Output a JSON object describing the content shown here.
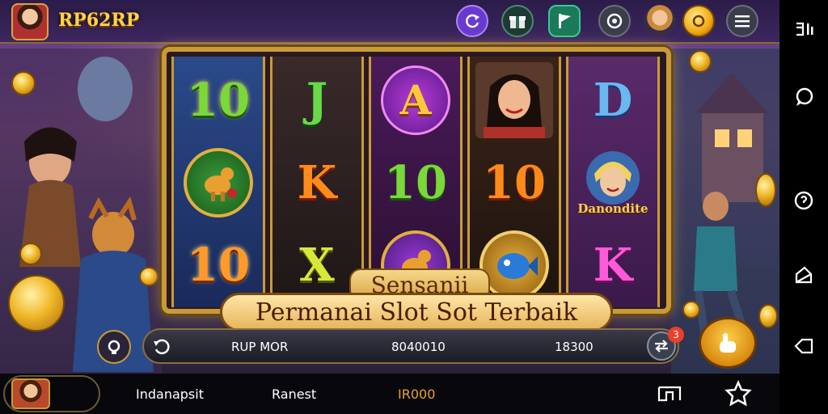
{
  "header": {
    "brand": "RP62RP",
    "icons": [
      "refresh-icon",
      "gift-icon",
      "flag-icon",
      "record-icon",
      "avatar-icon",
      "coin-icon",
      "menu-icon"
    ]
  },
  "reels": [
    [
      "10",
      "camel-symbol",
      "10"
    ],
    [
      "J",
      "K",
      "X"
    ],
    [
      "A",
      "10",
      "camel-symbol"
    ],
    [
      "woman-portrait",
      "10",
      "fish-symbol"
    ],
    [
      "D",
      "Danondite",
      "K"
    ]
  ],
  "banner": {
    "line1": "Sensanii",
    "line2": "Permanai Slot Sot Terbaik"
  },
  "controls": {
    "label1": "RUP MOR",
    "value1": "8040010",
    "value2": "18300",
    "badge": "3"
  },
  "bottom_bar": {
    "item1": "Indanapsit",
    "item2": "Ranest",
    "item3": "IR000"
  },
  "colors": {
    "gold": "#ffd24a",
    "frame": "#c99a3a",
    "background": "#1b1230"
  }
}
